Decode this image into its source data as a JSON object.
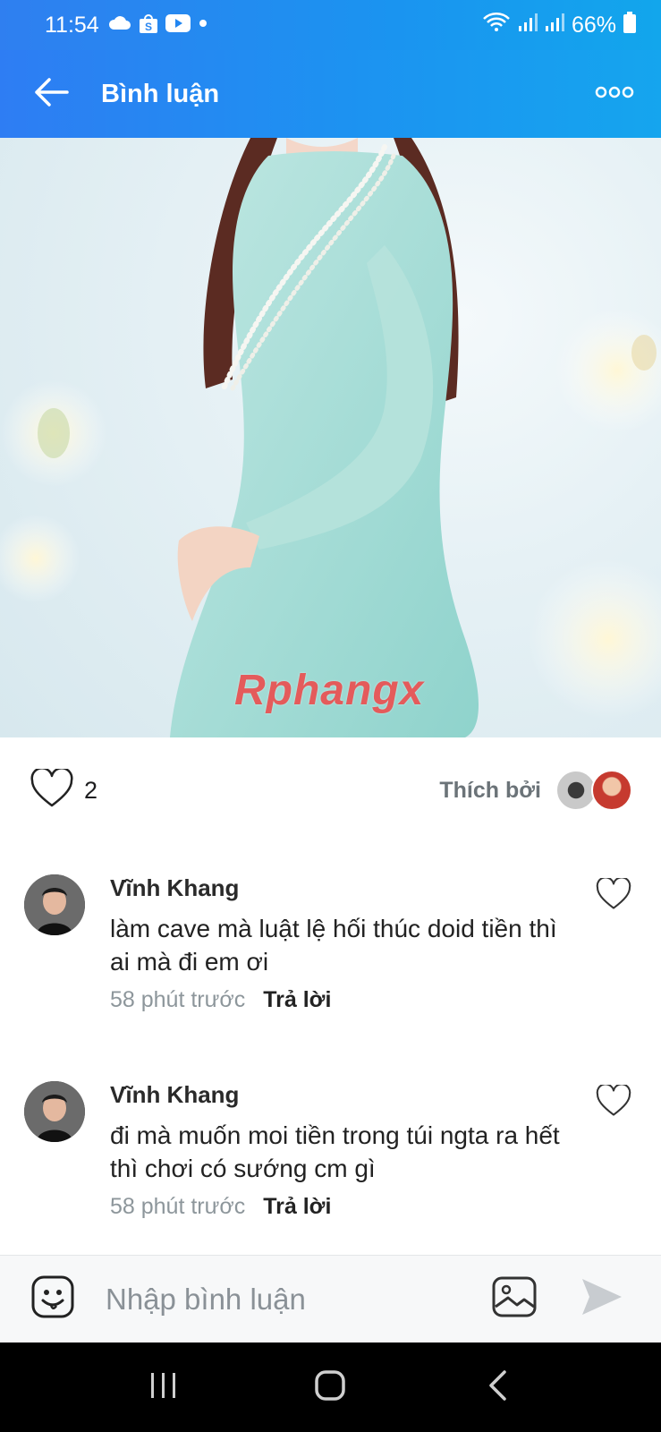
{
  "status_bar": {
    "time": "11:54",
    "battery": "66%",
    "left_icons": [
      "cloud-icon",
      "shopee-icon",
      "youtube-icon",
      "dot-icon"
    ],
    "right_icons": [
      "wifi-icon",
      "signal-icon",
      "signal-icon",
      "battery-icon"
    ]
  },
  "app_bar": {
    "title": "Bình luận",
    "back_icon": "back-arrow-icon",
    "more_icon": "more-dots-icon"
  },
  "post": {
    "watermark_a": "Rphang",
    "watermark_b": "x",
    "like_count": "2",
    "liked_by_label": "Thích bởi"
  },
  "comments": [
    {
      "author": "Vĩnh Khang",
      "text": "làm cave mà luật lệ hối thúc doid tiền thì ai mà đi em ơi",
      "time": "58 phút trước",
      "reply_label": "Trả lời"
    },
    {
      "author": "Vĩnh Khang",
      "text": "đi mà muốn moi tiền trong túi ngta ra hết thì chơi có sướng cm gì",
      "time": "58 phút trước",
      "reply_label": "Trả lời"
    }
  ],
  "input_bar": {
    "placeholder": "Nhập bình luận",
    "value": ""
  },
  "colors": {
    "header_start": "#2e7df3",
    "header_end": "#15a5ee",
    "ao_dai": "#a9dcd6",
    "watermark_red": "#e45b5b",
    "watermark_blue": "#4f7ef2"
  }
}
